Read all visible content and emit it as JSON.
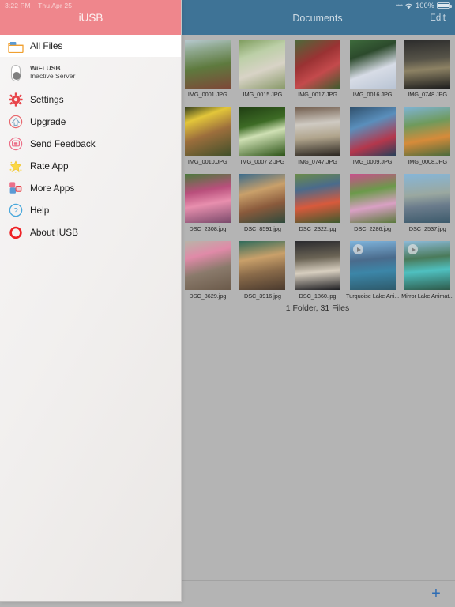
{
  "status_bar": {
    "time": "3:22 PM",
    "date": "Thu Apr 25",
    "battery_percent": "100%",
    "signal_dots": "••••",
    "wifi_icon": "wifi-icon",
    "battery_icon": "battery-icon"
  },
  "sidebar": {
    "title": "iUSB",
    "header_color": "#ef868c",
    "items": [
      {
        "label": "All Files",
        "icon": "folder-icon",
        "active": true
      },
      {
        "label": "WiFi USB",
        "sublabel": "Inactive Server",
        "icon": "toggle-switch-off-icon",
        "active": false
      },
      {
        "label": "Settings",
        "icon": "gear-icon",
        "active": false
      },
      {
        "label": "Upgrade",
        "icon": "upgrade-arrow-icon",
        "active": false
      },
      {
        "label": "Send Feedback",
        "icon": "feedback-icon",
        "active": false
      },
      {
        "label": "Rate App",
        "icon": "star-icon",
        "active": false
      },
      {
        "label": "More Apps",
        "icon": "apps-grid-icon",
        "active": false
      },
      {
        "label": "Help",
        "icon": "question-circle-icon",
        "active": false
      },
      {
        "label": "About iUSB",
        "icon": "ring-icon",
        "active": false
      }
    ]
  },
  "documents": {
    "title": "Documents",
    "edit_label": "Edit",
    "header_color": "#3e7396",
    "summary": "1 Folder, 31 Files",
    "add_label": "+",
    "add_icon": "plus-icon",
    "rows": [
      [
        {
          "label": "IMG_0001.JPG",
          "type": "image",
          "bg": "linear-gradient(170deg,#b9cbd3 0%,#8fa88f 22%,#5e7a3e 55%,#7d4838 100%)"
        },
        {
          "label": "IMG_0015.JPG",
          "type": "image",
          "bg": "linear-gradient(160deg,#7d9b5c 0%,#bccfa7 30%,#d8d3c6 60%,#8a9a6b 100%)"
        },
        {
          "label": "IMG_0017.JPG",
          "type": "image",
          "bg": "linear-gradient(150deg,#4a6b3a 0%,#9a3233 40%,#c44a4c 65%,#3d5c2e 100%)"
        },
        {
          "label": "IMG_0016.JPG",
          "type": "image",
          "bg": "linear-gradient(160deg,#3e6b3c 0%,#2c4a2c 30%,#d7dce6 62%,#b9c4d4 100%)"
        },
        {
          "label": "IMG_0748.JPG",
          "type": "image",
          "bg": "linear-gradient(175deg,#2b2b2b 0%,#565348 40%,#8d8264 60%,#1e1e1e 100%)"
        }
      ],
      [
        {
          "label": "IMG_0010.JPG",
          "type": "image",
          "bg": "linear-gradient(160deg,#2e3a1c 0%,#e3c63a 25%,#9c6e3c 55%,#41502a 100%)"
        },
        {
          "label": "IMG_0007 2.JPG",
          "type": "image",
          "bg": "linear-gradient(165deg,#1f3d12 0%,#3d6b25 35%,#cfe0b4 55%,#2d5418 100%)"
        },
        {
          "label": "IMG_0747.JPG",
          "type": "image",
          "bg": "linear-gradient(175deg,#6f5a4a 0%,#cfcac2 35%,#b0a48c 62%,#2a2520 100%)"
        },
        {
          "label": "IMG_0009.JPG",
          "type": "image",
          "bg": "linear-gradient(160deg,#2f4f6b 0%,#5a8fbc 35%,#b4374c 70%,#27405a 100%)"
        },
        {
          "label": "IMG_0008.JPG",
          "type": "image",
          "bg": "linear-gradient(170deg,#7fb4d6 0%,#6f9a5c 35%,#d68b3a 65%,#4a6b3c 100%)"
        }
      ],
      [
        {
          "label": "DSC_2308.jpg",
          "type": "image",
          "bg": "linear-gradient(170deg,#4a7a3c 0%,#b94f7c 35%,#e88fae 60%,#7a4a6b 100%)"
        },
        {
          "label": "DSC_8591.jpg",
          "type": "image",
          "bg": "linear-gradient(165deg,#3a6b8c 0%,#c9a06a 35%,#8a5a3c 65%,#2e4a3c 100%)"
        },
        {
          "label": "DSC_2322.jpg",
          "type": "image",
          "bg": "linear-gradient(170deg,#6b8c4a 0%,#4a6b8c 30%,#d85a3c 62%,#3c5a2e 100%)"
        },
        {
          "label": "DSC_2286.jpg",
          "type": "image",
          "bg": "linear-gradient(170deg,#c94f8c 0%,#6b9a4a 35%,#d9a0c4 65%,#5a7a3c 100%)"
        },
        {
          "label": "DSC_2537.jpg",
          "type": "image",
          "bg": "linear-gradient(175deg,#86b6d8 0%,#9aa8a0 42%,#6b7c8c 65%,#3c5a6b 100%)"
        }
      ],
      [
        {
          "label": "DSC_8629.jpg",
          "type": "image",
          "bg": "linear-gradient(165deg,#b9b4a8 0%,#e08aa8 30%,#8a7a6b 60%,#6b5a4a 100%)"
        },
        {
          "label": "DSC_3916.jpg",
          "type": "image",
          "bg": "linear-gradient(170deg,#2e6b5a 0%,#c9a06a 35%,#8a6b4a 62%,#4a3a2e 100%)"
        },
        {
          "label": "DSC_1860.jpg",
          "type": "image",
          "bg": "linear-gradient(175deg,#2a2a2e 0%,#6b6455 35%,#d8cfc0 62%,#1e1e22 100%)"
        },
        {
          "label": "Turquoise Lake Ani...",
          "type": "video",
          "bg": "linear-gradient(175deg,#7fb4dc 0%,#4a6b8c 38%,#3c86a8 62%,#2e5a6b 100%)"
        },
        {
          "label": "Mirror Lake Animat...",
          "type": "video",
          "bg": "linear-gradient(175deg,#8cbad8 0%,#4a7a5a 35%,#4fc0c0 60%,#2e5a4a 100%)"
        }
      ]
    ]
  }
}
